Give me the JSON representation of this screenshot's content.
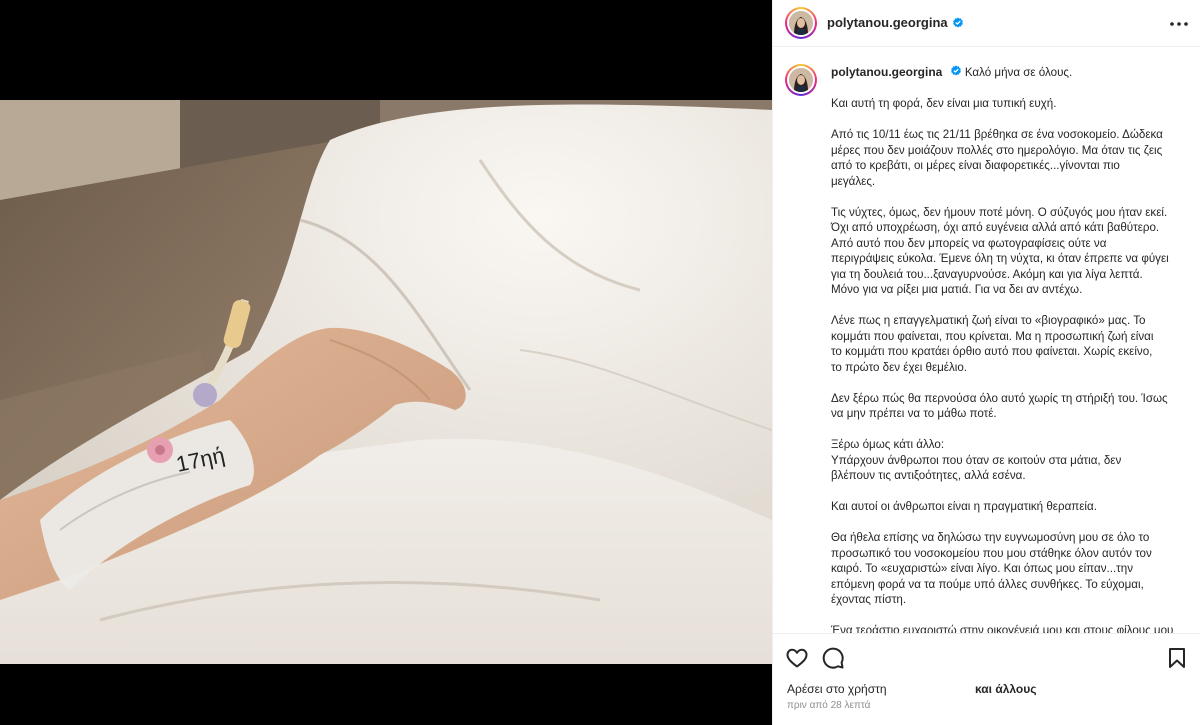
{
  "post": {
    "username": "polytanou.georgina",
    "verified": true,
    "more_icon": "more-horizontal-icon",
    "tag_text": "17ηή"
  },
  "caption": {
    "first_line": "Καλό μήνα σε όλους.",
    "paragraphs": [
      "Και αυτή τη φορά, δεν είναι μια τυπική ευχή.",
      "Από τις 10/11 έως τις 21/11 βρέθηκα σε ένα νοσοκομείο. Δώδεκα\nμέρες που δεν μοιάζουν πολλές στο ημερολόγιο. Μα όταν τις ζεις\nαπό το κρεβάτι, οι μέρες είναι διαφορετικές...γίνονται πιο\nμεγάλες.",
      "Τις νύχτες, όμως, δεν ήμουν ποτέ μόνη. Ο σύζυγός μου ήταν εκεί.\nΌχι από υποχρέωση, όχι από ευγένεια αλλά από κάτι βαθύτερο.\nΑπό αυτό που δεν μπορείς να φωτογραφίσεις ούτε να\nπεριγράψεις εύκολα. Έμενε όλη τη νύχτα, κι όταν έπρεπε να φύγει\nγια τη δουλειά του...ξαναγυρνούσε. Ακόμη και για λίγα λεπτά.\nΜόνο για να ρίξει μια ματιά. Για να δει αν αντέχω.",
      "Λένε πως η επαγγελματική ζωή είναι το «βιογραφικό» μας. Το\nκομμάτι που φαίνεται, που κρίνεται. Μα η προσωπική ζωή είναι\nτο κομμάτι που κρατάει όρθιο αυτό που φαίνεται. Χωρίς εκείνο,\nτο πρώτο δεν έχει θεμέλιο.",
      "Δεν ξέρω πώς θα περνούσα όλο αυτό χωρίς τη στήριξή του. Ίσως\nνα μην πρέπει να το μάθω ποτέ.",
      "Ξέρω όμως κάτι άλλο:\nΥπάρχουν άνθρωποι που όταν σε κοιτούν στα μάτια, δεν\nβλέπουν τις αντιξοότητες, αλλά εσένα.",
      "Και αυτοί οι άνθρωποι είναι η πραγματική θεραπεία.",
      "Θα ήθελα επίσης να δηλώσω την ευγνωμοσύνη μου σε όλο το\nπροσωπικό του νοσοκομείου που μου στάθηκε όλον αυτόν τον\nκαιρό. Το «ευχαριστώ» είναι λίγο. Και όπως μου είπαν...την\nεπόμενη φορά να τα πούμε υπό άλλες συνθήκες. Το εύχομαι,\nέχοντας πίστη.",
      "Ένα τεράστιο ευχαριστώ στην οικογένειά μου και στους φίλους μου"
    ]
  },
  "actions": {
    "like_icon": "heart-icon",
    "comment_icon": "comment-bubble-icon",
    "save_icon": "bookmark-icon",
    "liked_by_text": "Αρέσει στο χρήστη",
    "others_text": "και άλλους",
    "timestamp": "πριν από 28 λεπτά"
  },
  "colors": {
    "verified_badge": "#0095f6",
    "text_primary": "#262626",
    "text_secondary": "#8e8e8e",
    "divider": "#efefef"
  }
}
